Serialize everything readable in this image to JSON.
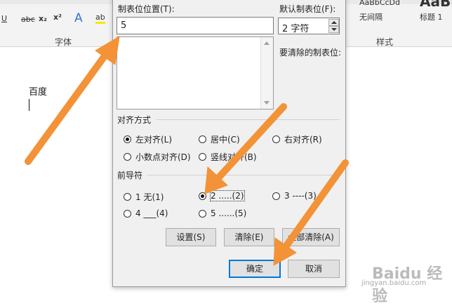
{
  "ribbon": {
    "font_tools": {
      "underline": "U",
      "strike": "abc",
      "subscript": "x₂",
      "superscript": "x²",
      "text_effect": "A",
      "highlight": "ab"
    },
    "group_font": "字体",
    "group_styles": "样式",
    "styles": [
      {
        "preview": "AaBbCcDd",
        "name": "无间隔"
      },
      {
        "preview": "AaBl",
        "name": "标题 1"
      }
    ]
  },
  "document": {
    "text": "百度"
  },
  "dialog": {
    "tab_position_label": "制表位位置(T):",
    "tab_position_value": "5",
    "default_tab_label": "默认制表位(F):",
    "default_tab_value": "2 字符",
    "clear_label": "要清除的制表位:",
    "alignment_label": "对齐方式",
    "alignment_options": [
      "左对齐(L)",
      "居中(C)",
      "右对齐(R)",
      "小数点对齐(D)",
      "竖线对齐(B)"
    ],
    "alignment_selected": "左对齐(L)",
    "leader_label": "前导符",
    "leader_options": [
      "1 无(1)",
      "2 .....(2)",
      "3 ----(3)",
      "4 ___(4)",
      "5 ......(5)"
    ],
    "leader_selected": "2 .....(2)",
    "buttons": {
      "set": "设置(S)",
      "clear": "清除(E)",
      "clear_all": "全部清除(A)",
      "ok": "确定",
      "cancel": "取消"
    }
  },
  "watermark": {
    "brand": "Baidu 经验",
    "url": "jingyan.baidu.com"
  },
  "colors": {
    "arrow": "#f39236",
    "default_button_border": "#0078d7",
    "dialog_bg": "#f0f0f0"
  }
}
